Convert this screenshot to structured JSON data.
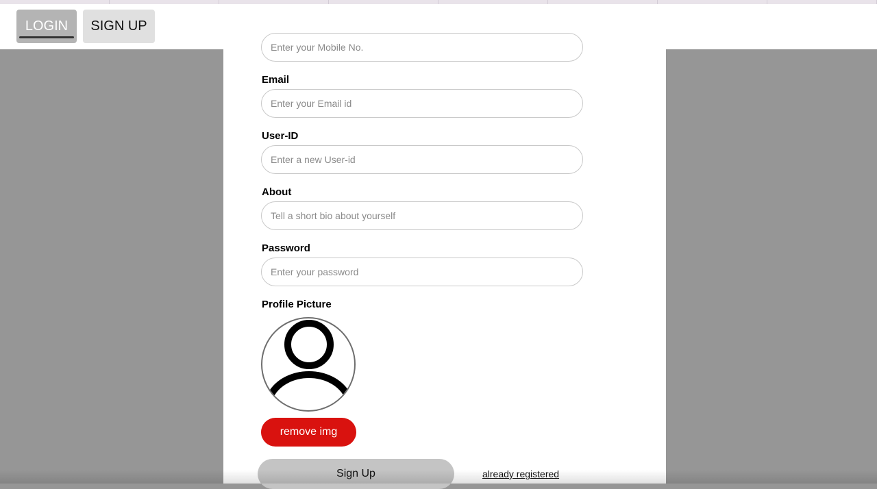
{
  "nav": {
    "login_label": "LOGIN",
    "signup_label": "SIGN UP"
  },
  "form": {
    "mobile": {
      "placeholder": "Enter your Mobile No."
    },
    "email": {
      "label": "Email",
      "placeholder": "Enter your Email id"
    },
    "userid": {
      "label": "User-ID",
      "placeholder": "Enter a new User-id"
    },
    "about": {
      "label": "About",
      "placeholder": "Tell a short bio about yourself"
    },
    "password": {
      "label": "Password",
      "placeholder": "Enter your password"
    },
    "profile_picture": {
      "label": "Profile Picture",
      "icon": "user-avatar-icon"
    },
    "remove_img_label": "remove img",
    "signup_button_label": "Sign Up",
    "already_registered_label": "already registered"
  },
  "colors": {
    "backdrop": "#969696",
    "remove_button": "#d9120f",
    "signup_button": "#c4c4c4"
  }
}
